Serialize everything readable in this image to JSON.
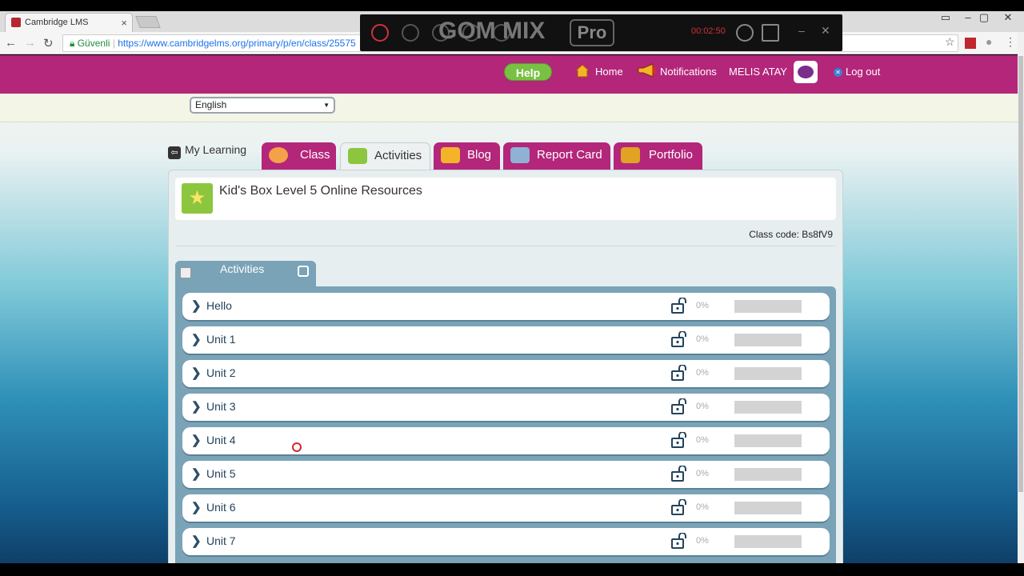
{
  "browser": {
    "tab_title": "Cambridge LMS",
    "tab_close": "×",
    "security_label": "Güvenli",
    "url": "https://www.cambridgelms.org/primary/p/en/class/25575",
    "star_icon": "star-icon",
    "window_controls": [
      "minimize-icon",
      "maximize-icon",
      "close-icon"
    ]
  },
  "recorder": {
    "brand": "GOM MIX",
    "brand_suffix": "Pro",
    "timer": "00:02:50"
  },
  "header": {
    "help": "Help",
    "home": "Home",
    "notifications": "Notifications",
    "user": "MELIS ATAY",
    "logout": "Log out"
  },
  "language": {
    "selected": "English"
  },
  "nav": {
    "my_learning": "My Learning",
    "tabs": [
      {
        "label": "Class",
        "icon": "class-icon",
        "active": false
      },
      {
        "label": "Activities",
        "icon": "activities-icon",
        "active": true
      },
      {
        "label": "Blog",
        "icon": "blog-icon",
        "active": false
      },
      {
        "label": "Report Card",
        "icon": "report-card-icon",
        "active": false
      },
      {
        "label": "Portfolio",
        "icon": "portfolio-icon",
        "active": false
      }
    ]
  },
  "course": {
    "title": "Kid's Box Level 5 Online Resources",
    "class_code_label": "Class code: ",
    "class_code": "Bs8fV9"
  },
  "activities": {
    "tab_label": "Activities",
    "items": [
      {
        "name": "Hello",
        "progress": "0%",
        "fraction": 0
      },
      {
        "name": "Unit 1",
        "progress": "0%",
        "fraction": 0
      },
      {
        "name": "Unit 2",
        "progress": "0%",
        "fraction": 0
      },
      {
        "name": "Unit 3",
        "progress": "0%",
        "fraction": 0
      },
      {
        "name": "Unit 4",
        "progress": "0%",
        "fraction": 0
      },
      {
        "name": "Unit 5",
        "progress": "0%",
        "fraction": 0
      },
      {
        "name": "Unit 6",
        "progress": "0%",
        "fraction": 0
      },
      {
        "name": "Unit 7",
        "progress": "0%",
        "fraction": 0
      }
    ]
  },
  "colors": {
    "header": "#b3267a",
    "help_button": "#79c142",
    "list_frame": "#7aa3b7",
    "progress_track": "#d3d3d3"
  }
}
